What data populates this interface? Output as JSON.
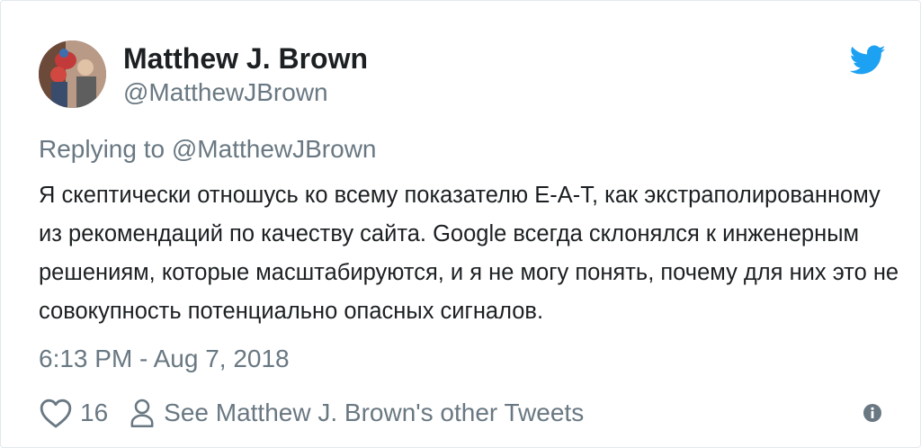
{
  "tweet": {
    "author_name": "Matthew J. Brown",
    "author_handle": "@MatthewJBrown",
    "replying_prefix": "Replying to",
    "replying_to": "@MatthewJBrown",
    "text": "Я скептически отношусь ко всему показателю E-A-T, как экстраполированному из рекомендаций по качеству сайта. Google всегда склонялся к инженерным решениям, которые масштабируются, и я не могу понять, почему для них это не совокупность потенциально опасных сигналов.",
    "timestamp": "6:13 PM - Aug 7, 2018",
    "like_count": "16",
    "see_other_label": "See Matthew J. Brown's other Tweets"
  },
  "icons": {
    "brand": "twitter-bird-icon",
    "like": "heart-icon",
    "profile": "person-icon",
    "info": "info-icon"
  },
  "colors": {
    "twitter_blue": "#1da1f2",
    "secondary_text": "#697882",
    "primary_text": "#1c2022"
  }
}
